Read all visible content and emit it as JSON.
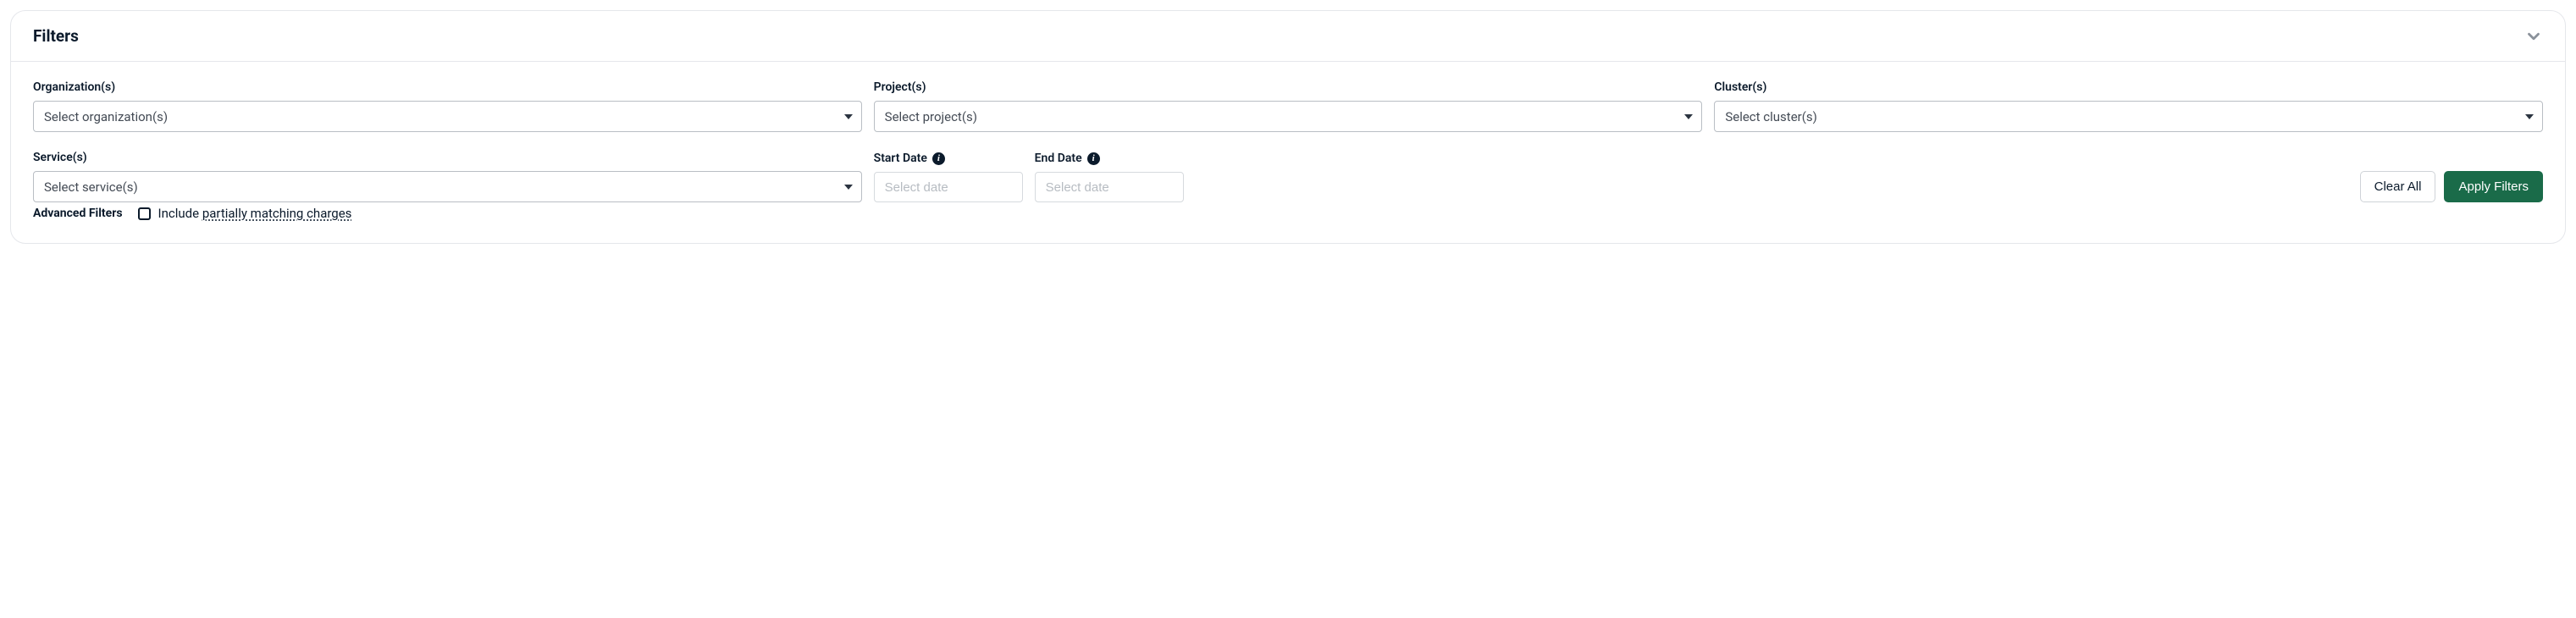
{
  "header": {
    "title": "Filters"
  },
  "fields": {
    "organization": {
      "label": "Organization(s)",
      "placeholder": "Select organization(s)"
    },
    "project": {
      "label": "Project(s)",
      "placeholder": "Select project(s)"
    },
    "cluster": {
      "label": "Cluster(s)",
      "placeholder": "Select cluster(s)"
    },
    "service": {
      "label": "Service(s)",
      "placeholder": "Select service(s)"
    },
    "start_date": {
      "label": "Start Date",
      "placeholder": "Select date"
    },
    "end_date": {
      "label": "End Date",
      "placeholder": "Select date"
    }
  },
  "buttons": {
    "clear": "Clear All",
    "apply": "Apply Filters"
  },
  "advanced": {
    "title": "Advanced Filters",
    "include_prefix": "Include ",
    "include_underlined": "partially matching charges"
  }
}
